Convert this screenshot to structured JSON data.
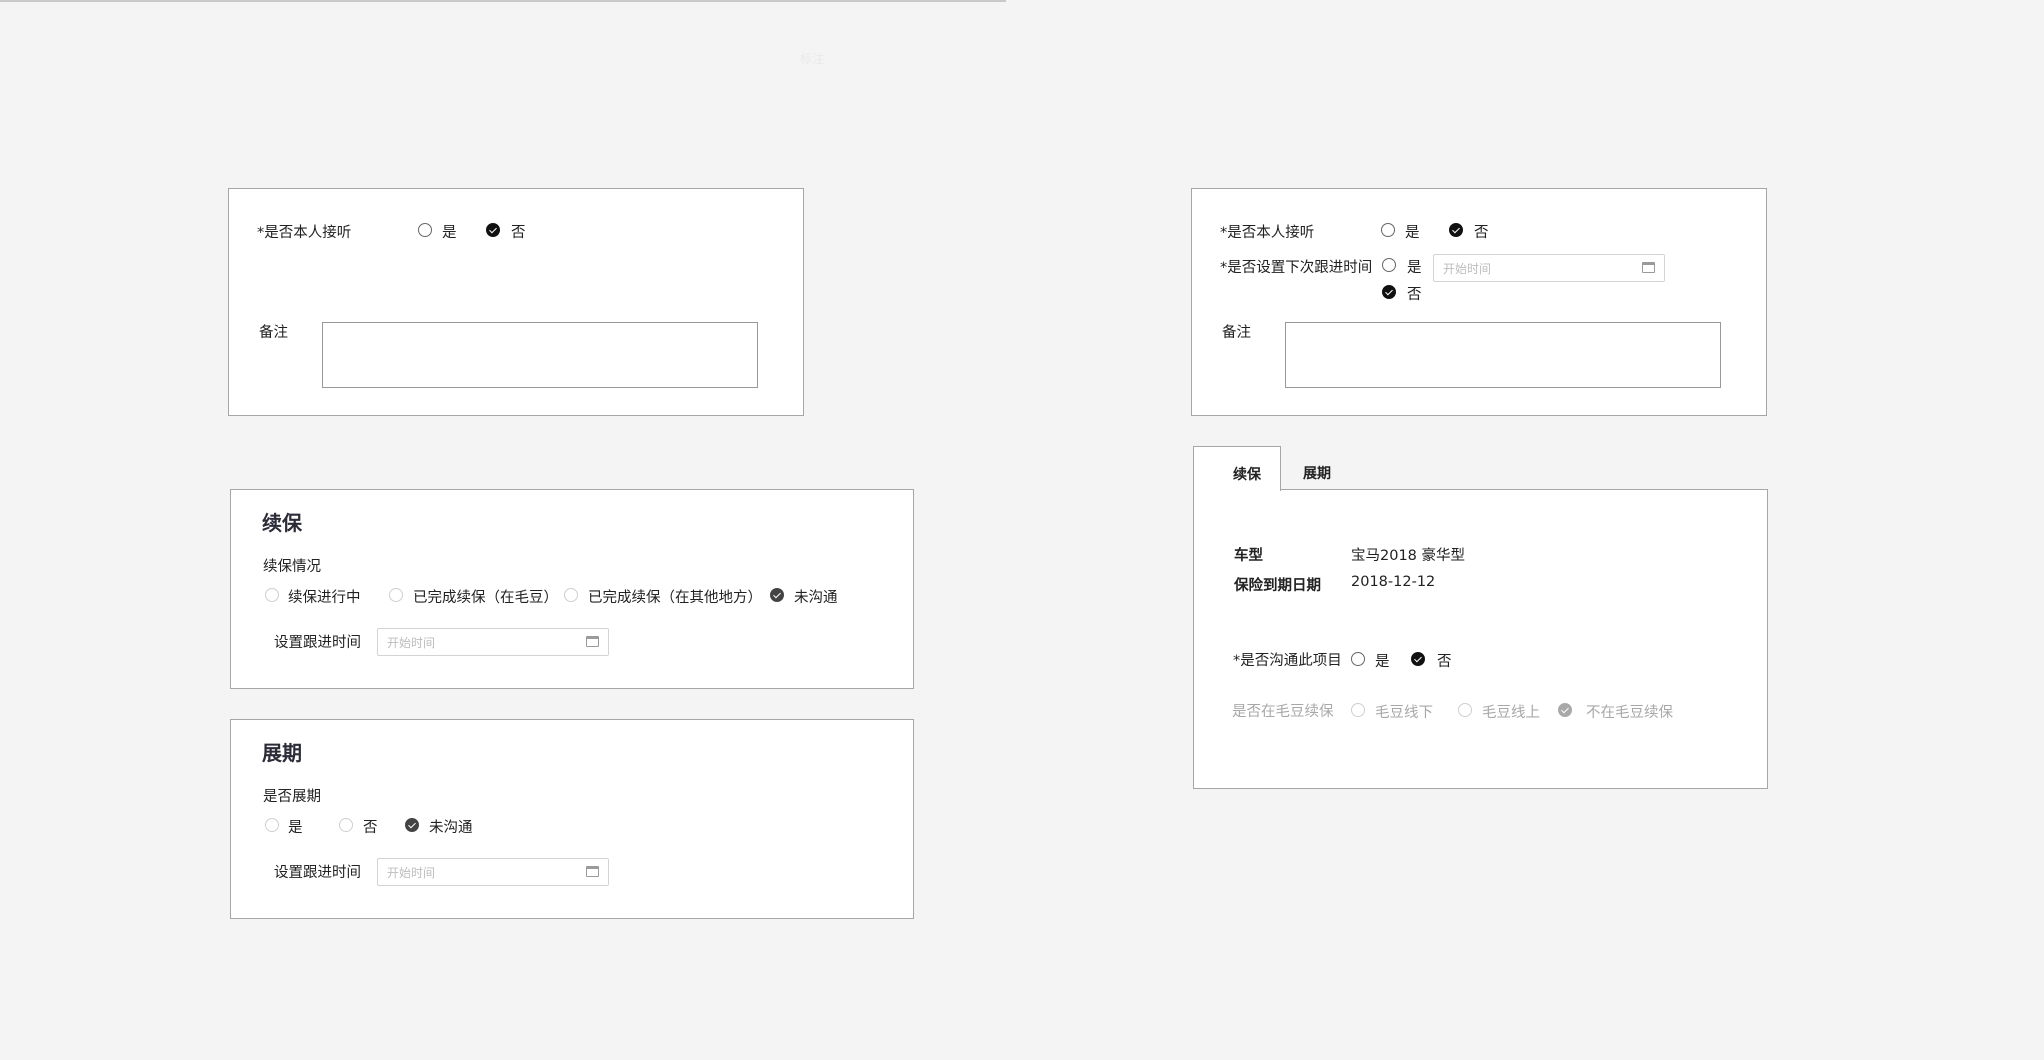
{
  "ghost_text": "标注",
  "panel1": {
    "answer_label": "*是否本人接听",
    "opt_yes": "是",
    "opt_no": "否",
    "remark_label": "备注"
  },
  "panel2": {
    "answer_label": "*是否本人接听",
    "opt_yes": "是",
    "opt_no": "否",
    "next_label": "*是否设置下次跟进时间",
    "next_yes": "是",
    "next_no": "否",
    "date_placeholder": "开始时间",
    "remark_label": "备注"
  },
  "renewal": {
    "title": "续保",
    "status_label": "续保情况",
    "options": [
      "续保进行中",
      "已完成续保（在毛豆）",
      "已完成续保（在其他地方）",
      "未沟通"
    ],
    "selected": "未沟通",
    "followup_label": "设置跟进时间",
    "date_placeholder": "开始时间"
  },
  "extension": {
    "title": "展期",
    "question_label": "是否展期",
    "options": [
      "是",
      "否",
      "未沟通"
    ],
    "selected": "未沟通",
    "followup_label": "设置跟进时间",
    "date_placeholder": "开始时间"
  },
  "tabs": {
    "items": [
      "续保",
      "展期"
    ],
    "active": "续保"
  },
  "detail": {
    "car_label": "车型",
    "car_value": "宝马2018 豪华型",
    "expire_label": "保险到期日期",
    "expire_value": "2018-12-12",
    "comm_label": "*是否沟通此项目",
    "comm_yes": "是",
    "comm_no": "否",
    "maodou_label": "是否在毛豆续保",
    "maodou_opts": [
      "毛豆线下",
      "毛豆线上",
      "不在毛豆续保"
    ],
    "maodou_selected": "不在毛豆续保"
  }
}
